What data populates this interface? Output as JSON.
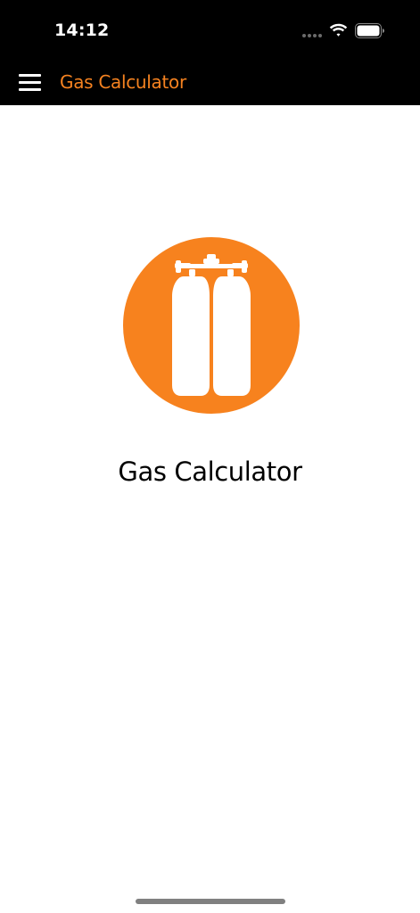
{
  "status_bar": {
    "time": "14:12",
    "icons": [
      "signal-dots-icon",
      "wifi-icon",
      "battery-icon"
    ]
  },
  "app_bar": {
    "title": "Gas Calculator",
    "menu_icon": "hamburger-menu-icon"
  },
  "main": {
    "logo_icon": "twin-gas-cylinders-icon",
    "title": "Gas Calculator"
  },
  "colors": {
    "accent": "#f58220",
    "bar_background": "#000000",
    "background": "#ffffff",
    "logo_circle": "#f7821e"
  }
}
